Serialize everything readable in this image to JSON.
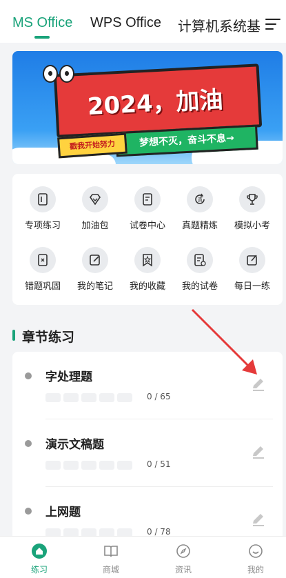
{
  "top_tabs": {
    "items": [
      "MS Office",
      "WPS Office",
      "计算机系统基"
    ],
    "active_index": 0
  },
  "banner": {
    "headline": "2024，加油",
    "tag_left": "戳我开始努力",
    "tag_right": "梦想不灭，奋斗不息→"
  },
  "grid": {
    "items": [
      {
        "label": "专项练习",
        "icon": "book-icon"
      },
      {
        "label": "加油包",
        "icon": "diamond-icon"
      },
      {
        "label": "试卷中心",
        "icon": "paper-icon"
      },
      {
        "label": "真题精炼",
        "icon": "refresh-icon"
      },
      {
        "label": "模拟小考",
        "icon": "trophy-icon"
      },
      {
        "label": "错题巩固",
        "icon": "wrong-book-icon"
      },
      {
        "label": "我的笔记",
        "icon": "note-icon"
      },
      {
        "label": "我的收藏",
        "icon": "star-bookmark-icon"
      },
      {
        "label": "我的试卷",
        "icon": "my-paper-icon"
      },
      {
        "label": "每日一练",
        "icon": "daily-edit-icon"
      }
    ]
  },
  "section": {
    "title": "章节练习"
  },
  "chapters": [
    {
      "title": "字处理题",
      "progress": "0 / 65"
    },
    {
      "title": "演示文稿题",
      "progress": "0 / 51"
    },
    {
      "title": "上网题",
      "progress": "0 / 78"
    }
  ],
  "bottom_nav": {
    "items": [
      "练习",
      "商城",
      "资讯",
      "我的"
    ],
    "active_index": 0
  },
  "colors": {
    "accent": "#1aa37a",
    "banner_red": "#e53a3a",
    "arrow_red": "#e53a3a"
  }
}
